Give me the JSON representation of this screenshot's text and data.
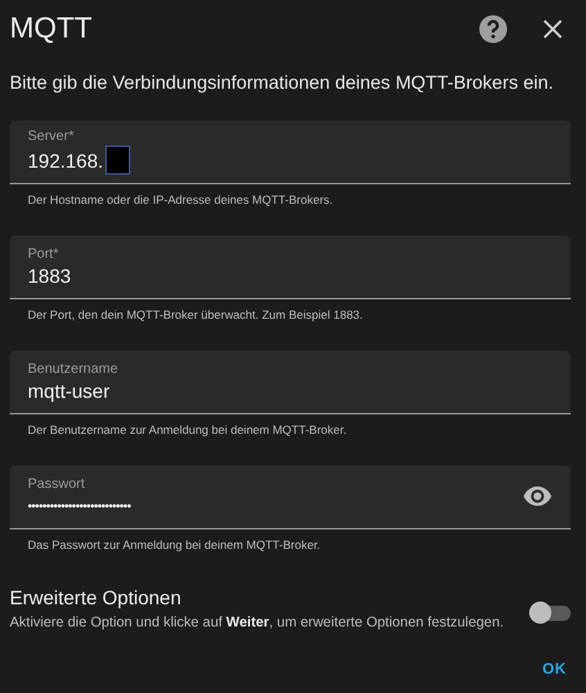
{
  "dialog": {
    "title": "MQTT",
    "intro": "Bitte gib die Verbindungsinformationen deines MQTT-Brokers ein."
  },
  "fields": [
    {
      "kind": "text",
      "label": "Server*",
      "value": "192.168.",
      "redacted": true,
      "helper": "Der Hostname oder die IP-Adresse deines MQTT-Brokers."
    },
    {
      "kind": "text",
      "label": "Port*",
      "value": "1883",
      "helper": "Der Port, den dein MQTT-Broker überwacht. Zum Beispiel 1883."
    },
    {
      "kind": "text",
      "label": "Benutzername",
      "value": "mqtt-user",
      "helper": "Der Benutzername zur Anmeldung bei deinem MQTT-Broker."
    },
    {
      "kind": "password",
      "label": "Passwort",
      "value": "••••••••••••••••••••••••••••",
      "helper": "Das Passwort zur Anmeldung bei deinem MQTT-Broker."
    }
  ],
  "advanced": {
    "title": "Erweiterte Optionen",
    "description": "Aktiviere die Option und klicke auf **Weiter**, um erweiterte Optionen festzulegen.",
    "on": false
  },
  "buttons": [
    "OK"
  ]
}
